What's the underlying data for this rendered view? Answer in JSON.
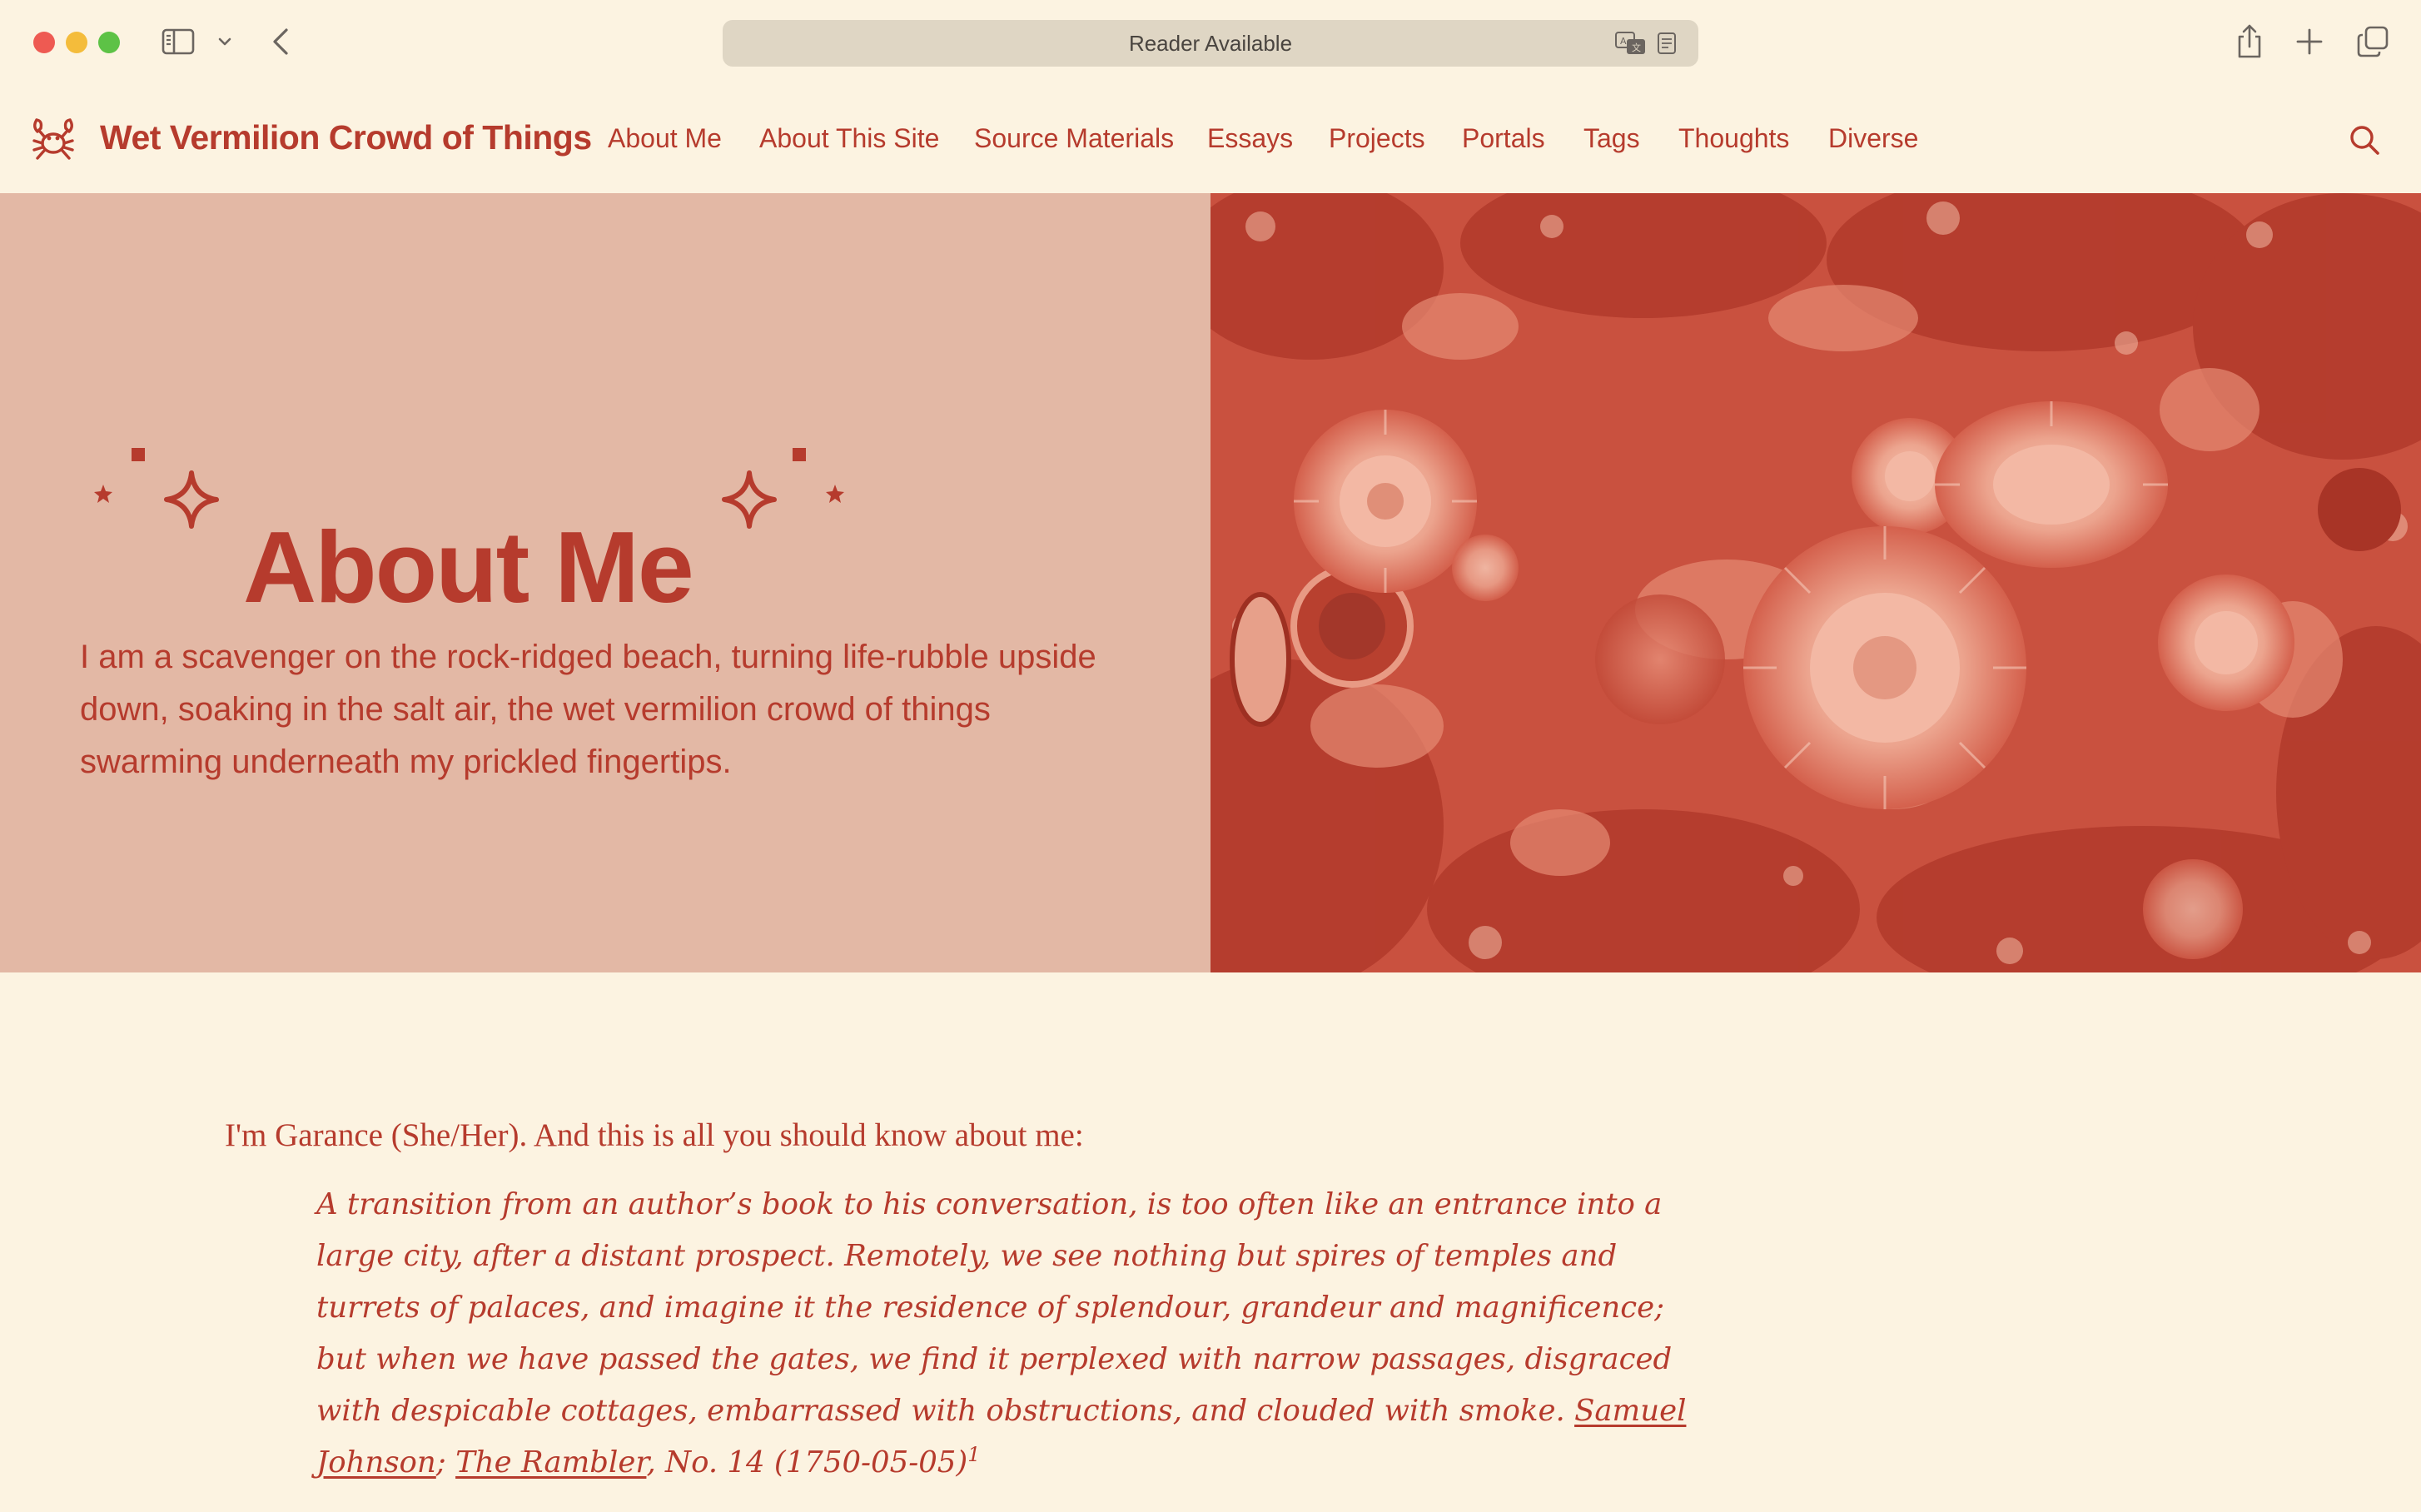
{
  "browser": {
    "address_text": "Reader Available"
  },
  "site": {
    "title": "Wet Vermilion Crowd of Things",
    "logo_icon": "crab-icon",
    "nav": [
      {
        "label": "About Me"
      },
      {
        "label": "About This Site"
      },
      {
        "label": "Source Materials"
      },
      {
        "label": "Essays"
      },
      {
        "label": "Projects"
      },
      {
        "label": "Portals"
      },
      {
        "label": "Tags"
      },
      {
        "label": "Thoughts"
      },
      {
        "label": "Diverse"
      }
    ]
  },
  "hero": {
    "title": "About Me",
    "subtitle": "I am a scavenger on the rock-ridged beach, turning life-rubble upside down, soaking in the salt air, the wet vermilion crowd of things swarming underneath my prickled fingertips.",
    "image_subject": "sea anemones in a tide pool",
    "image_tint": "#c9513f"
  },
  "content": {
    "intro": "I'm Garance (She/Her). And this is all you should know about me:",
    "quote": {
      "text": "A transition from an author’s book to his conversation, is too often like an entrance into a large city, after a distant prospect. Remotely, we see nothing but spires of temples and turrets of palaces, and imagine it the residence of splendour, grandeur and magnificence; but when we have passed the gates, we find it perplexed with narrow passages, disgraced with despicable cottages, embarrassed with obstructions, and clouded with smoke.",
      "author": "Samuel Johnson",
      "separator": ";",
      "work": "The Rambler",
      "citation_tail": ", No. 14 (1750-05-05)",
      "footnote": "1"
    }
  },
  "colors": {
    "accent": "#b63b2d",
    "background": "#fcf3e1",
    "hero_panel": "#e3b8a5"
  }
}
